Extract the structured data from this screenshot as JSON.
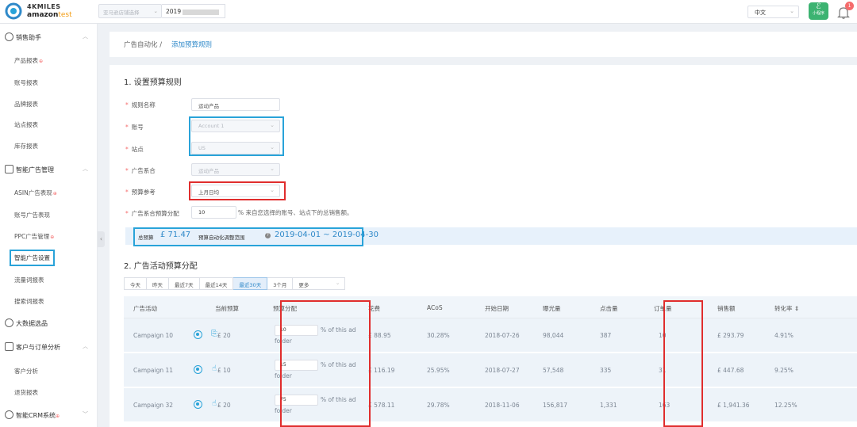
{
  "header": {
    "brand_line1": "4KMILES",
    "brand_line2a": "amazon",
    "brand_line2b": "test",
    "account_select": "亚马逊店铺选择",
    "date_prefix": "2019",
    "language": "中文",
    "mini_program": "小程序",
    "notification_count": "1"
  },
  "sidebar": {
    "groups": [
      {
        "label": "销售助手",
        "items": [
          {
            "label": "产品报表",
            "hot": true
          },
          {
            "label": "账号报表",
            "hot": false
          },
          {
            "label": "品牌报表",
            "hot": false
          },
          {
            "label": "站点报表",
            "hot": false
          },
          {
            "label": "库存报表",
            "hot": false
          }
        ]
      },
      {
        "label": "智能广告管理",
        "items": [
          {
            "label": "ASIN广告表现",
            "hot": true
          },
          {
            "label": "账号广告表现",
            "hot": false
          },
          {
            "label": "PPC广告管理",
            "hot": true
          },
          {
            "label": "智能广告设置",
            "hot": false
          },
          {
            "label": "流量词报表",
            "hot": false
          },
          {
            "label": "搜索词报表",
            "hot": false
          }
        ]
      },
      {
        "label": "大数据选品",
        "items": []
      },
      {
        "label": "客户与订单分析",
        "items": [
          {
            "label": "客户分析",
            "hot": false
          },
          {
            "label": "退货报表",
            "hot": false
          }
        ]
      },
      {
        "label": "智能CRM系统",
        "items": []
      }
    ],
    "hot_mark": "⊕"
  },
  "breadcrumb": {
    "parent": "广告自动化 /",
    "current": "添加预算规则"
  },
  "form": {
    "section1_title": "1. 设置预算规则",
    "rule_name_label": "规则名称",
    "rule_name_value": "运动产品",
    "account_label": "账号",
    "account_value": "Account 1",
    "site_label": "站点",
    "site_value": "US",
    "ad_portfolio_label": "广告系合",
    "ad_portfolio_value": "运动产品",
    "budget_ref_label": "预算参考",
    "budget_ref_value": "上月日均",
    "portfolio_budget_label": "广告系合预算分配",
    "portfolio_budget_value": "10",
    "portfolio_budget_note": "% 来自您选择的账号、站点下的总销售额。",
    "required_mark": "*"
  },
  "budget_summary": {
    "total_label": "总预算",
    "total_value": "£ 71.47",
    "range_label": "预算自动化调整范围",
    "range_value": "2019-04-01 ~ 2019-04-30",
    "help": "?"
  },
  "allocation": {
    "section2_title": "2. 广告活动预算分配",
    "tabs": [
      {
        "label": "今天",
        "active": false
      },
      {
        "label": "昨天",
        "active": false
      },
      {
        "label": "最近7天",
        "active": false
      },
      {
        "label": "最近14天",
        "active": false
      },
      {
        "label": "最近30天",
        "active": true
      },
      {
        "label": "3个月",
        "active": false
      }
    ],
    "more_label": "更多"
  },
  "table": {
    "headers": [
      "广告活动",
      "当前预算",
      "预算分配",
      "花费",
      "ACoS",
      "开始日期",
      "曝光量",
      "点击量",
      "订单量",
      "销售额",
      "转化率 ⇕"
    ],
    "alloc_suffix": "% of this ad",
    "alloc_suffix2": "folder",
    "rows": [
      {
        "campaign": "Campaign 10",
        "icon2": "⎘",
        "budget": "£ 20",
        "alloc": "10",
        "spend": "£ 88.95",
        "acos": "30.28%",
        "start": "2018-07-26",
        "impr": "98,044",
        "clicks": "387",
        "orders": "10",
        "sales": "£ 293.79",
        "conv": "4.91%"
      },
      {
        "campaign": "Campaign 11",
        "icon2": "☝",
        "budget": "£ 10",
        "alloc": "15",
        "spend": "£ 116.19",
        "acos": "25.95%",
        "start": "2018-07-27",
        "impr": "57,548",
        "clicks": "335",
        "orders": "31",
        "sales": "£ 447.68",
        "conv": "9.25%"
      },
      {
        "campaign": "Campaign 32",
        "icon2": "☝",
        "budget": "£ 20",
        "alloc": "75",
        "spend": "£ 578.11",
        "acos": "29.78%",
        "start": "2018-11-06",
        "impr": "156,817",
        "clicks": "1,331",
        "orders": "163",
        "sales": "£ 1,941.36",
        "conv": "12.25%"
      }
    ]
  },
  "colors": {
    "highlight_blue": "#29a3d9",
    "highlight_red": "#e02d2d",
    "link_blue": "#2f89c9"
  }
}
